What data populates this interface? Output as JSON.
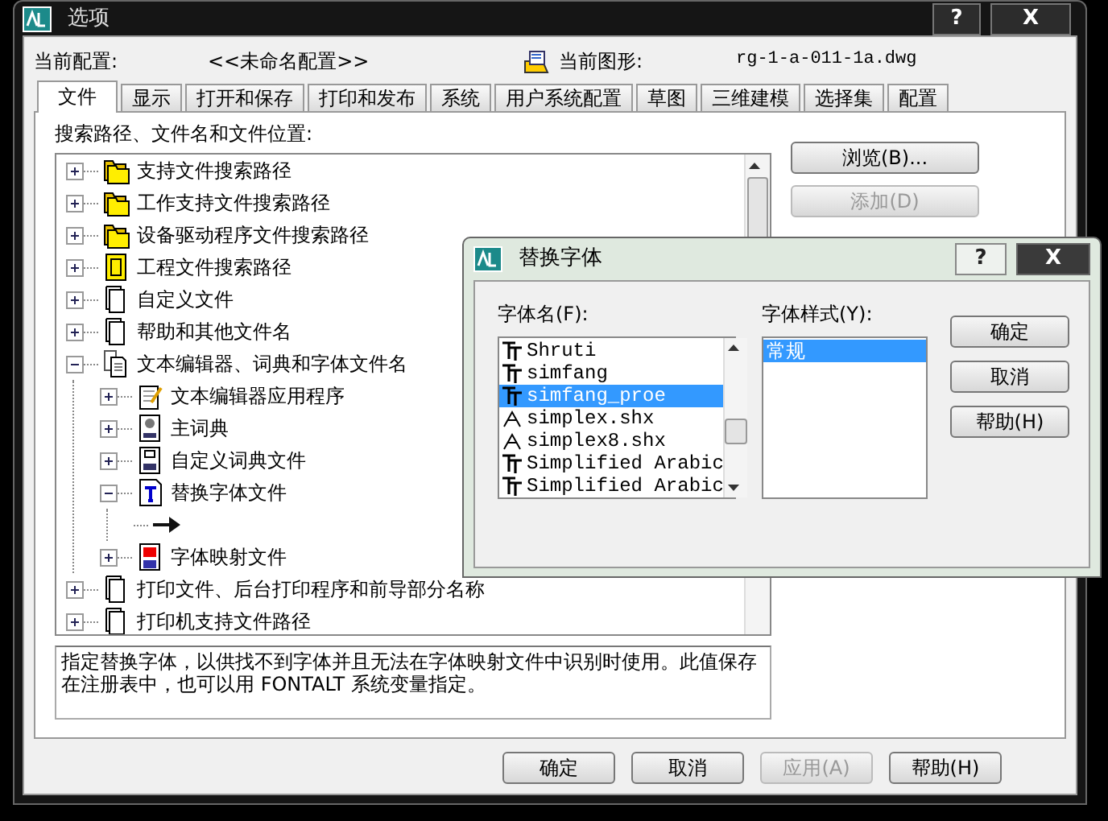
{
  "window": {
    "title": "选项",
    "help": "?",
    "close": "X"
  },
  "header": {
    "profile_label": "当前配置:",
    "profile": "<<未命名配置>>",
    "drawing_label": "当前图形:",
    "drawing": "rg-1-a-011-1a.dwg"
  },
  "tabs": [
    {
      "label": "文件",
      "selected": true
    },
    {
      "label": "显示",
      "selected": false
    },
    {
      "label": "打开和保存",
      "selected": false
    },
    {
      "label": "打印和发布",
      "selected": false
    },
    {
      "label": "系统",
      "selected": false
    },
    {
      "label": "用户系统配置",
      "selected": false
    },
    {
      "label": "草图",
      "selected": false
    },
    {
      "label": "三维建模",
      "selected": false
    },
    {
      "label": "选择集",
      "selected": false
    },
    {
      "label": "配置",
      "selected": false
    }
  ],
  "tree_label": "搜索路径、文件名和文件位置:",
  "tree": [
    {
      "label": "支持文件搜索路径",
      "kind": "folders",
      "expanded": false
    },
    {
      "label": "工作支持文件搜索路径",
      "kind": "folders",
      "expanded": false
    },
    {
      "label": "设备驱动程序文件搜索路径",
      "kind": "folders",
      "expanded": false
    },
    {
      "label": "工程文件搜索路径",
      "kind": "project",
      "expanded": false
    },
    {
      "label": "自定义文件",
      "kind": "file",
      "expanded": false
    },
    {
      "label": "帮助和其他文件名",
      "kind": "file",
      "expanded": false
    },
    {
      "label": "文本编辑器、词典和字体文件名",
      "kind": "files",
      "expanded": true,
      "children": [
        {
          "label": "文本编辑器应用程序",
          "kind": "editor",
          "expanded": false
        },
        {
          "label": "主词典",
          "kind": "dict",
          "expanded": false
        },
        {
          "label": "自定义词典文件",
          "kind": "customdict",
          "expanded": false
        },
        {
          "label": "替换字体文件",
          "kind": "font",
          "expanded": true,
          "children": [
            {
              "kind": "arrow"
            }
          ]
        },
        {
          "label": "字体映射文件",
          "kind": "fontmap",
          "expanded": false
        }
      ]
    },
    {
      "label": "打印文件、后台打印程序和前导部分名称",
      "kind": "file",
      "expanded": false
    },
    {
      "label": "打印机支持文件路径",
      "kind": "file",
      "expanded": false
    }
  ],
  "side_buttons": [
    {
      "label": "浏览(B)...",
      "disabled": false
    },
    {
      "label": "添加(D)",
      "disabled": true
    }
  ],
  "description": "指定替换字体，以供找不到字体并且无法在字体映射文件中识别时使用。此值保存在注册表中，也可以用 FONTALT 系统变量指定。",
  "buttons": [
    {
      "label": "确定",
      "disabled": false
    },
    {
      "label": "取消",
      "disabled": false
    },
    {
      "label": "应用(A)",
      "disabled": true
    },
    {
      "label": "帮助(H)",
      "disabled": false
    }
  ],
  "font_dialog": {
    "title": "替换字体",
    "help": "?",
    "close": "X",
    "name_label": "字体名(F):",
    "fonts": [
      {
        "name": "Shruti",
        "kind": "truetype",
        "selected": false
      },
      {
        "name": "simfang",
        "kind": "truetype",
        "selected": false
      },
      {
        "name": "simfang_proe",
        "kind": "truetype",
        "selected": true
      },
      {
        "name": "simplex.shx",
        "kind": "shx",
        "selected": false
      },
      {
        "name": "simplex8.shx",
        "kind": "shx",
        "selected": false
      },
      {
        "name": "Simplified Arabic",
        "kind": "truetype",
        "selected": false
      },
      {
        "name": "Simplified Arabic",
        "kind": "truetype",
        "selected": false
      }
    ],
    "style_label": "字体样式(Y):",
    "styles": [
      {
        "name": "常规",
        "selected": true
      }
    ],
    "buttons": [
      "确定",
      "取消",
      "帮助(H)"
    ]
  }
}
